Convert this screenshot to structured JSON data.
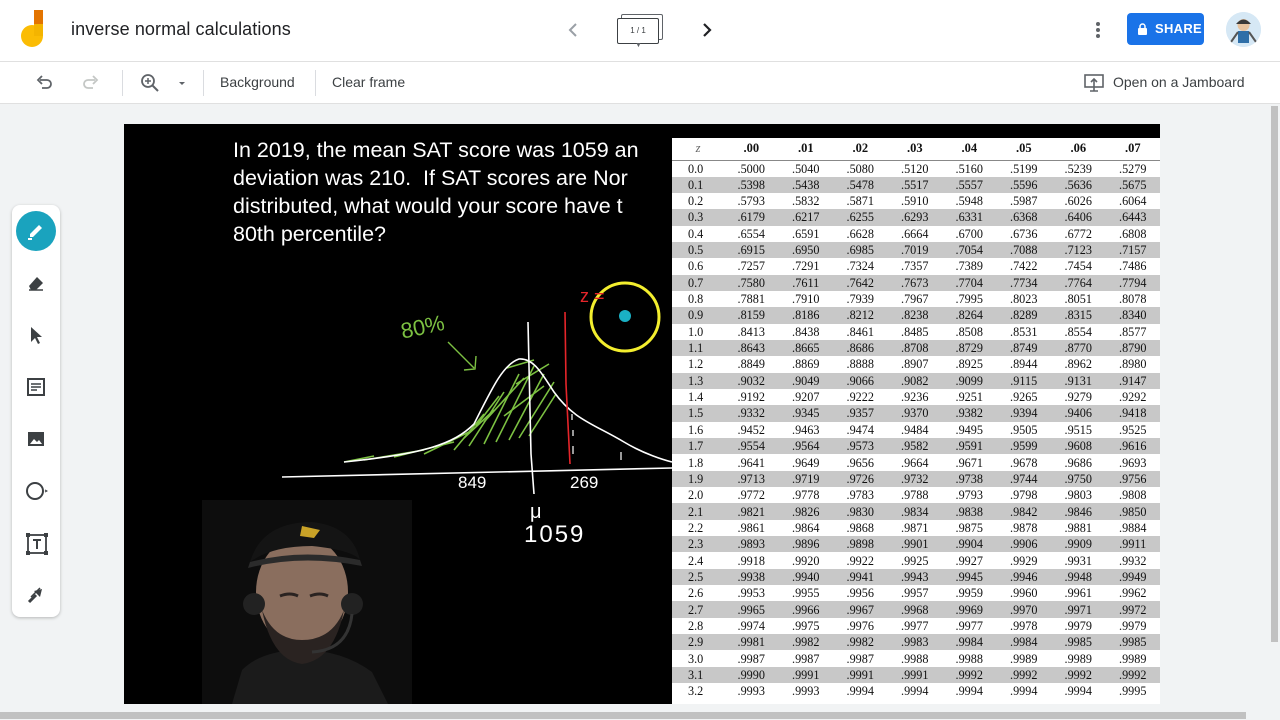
{
  "header": {
    "title": "inverse normal calculations",
    "frame_indicator": "1 / 1",
    "share_label": "SHARE",
    "brand_color": "#1a73e8",
    "logo_colors": [
      "#f4b400",
      "#fbbc04",
      "#e37400"
    ]
  },
  "toolbar": {
    "undo_icon": "undo-icon",
    "redo_icon": "redo-icon",
    "zoom_icon": "zoom-icon",
    "background_label": "Background",
    "clear_frame_label": "Clear frame",
    "open_jamboard_label": "Open on a Jamboard"
  },
  "tools": [
    {
      "name": "pen",
      "icon": "pen-icon",
      "active": true
    },
    {
      "name": "eraser",
      "icon": "eraser-icon"
    },
    {
      "name": "select",
      "icon": "cursor-icon"
    },
    {
      "name": "sticky-note",
      "icon": "sticky-note-icon"
    },
    {
      "name": "image",
      "icon": "image-icon"
    },
    {
      "name": "shape",
      "icon": "circle-icon"
    },
    {
      "name": "text-box",
      "icon": "text-box-icon"
    },
    {
      "name": "laser",
      "icon": "laser-icon"
    }
  ],
  "canvas": {
    "problem_text": "In 2019, the mean SAT score was 1059 an\ndeviation was 210.  If SAT scores are Nor\ndistributed, what would your score have t\n80th percentile?",
    "annotations": {
      "percent": "80%",
      "left_value": "849",
      "right_value": "269",
      "mu": "μ",
      "mean": "1059",
      "z_mark": "z ="
    },
    "z_table": {
      "headers": [
        "z",
        ".00",
        ".01",
        ".02",
        ".03",
        ".04",
        ".05",
        ".06",
        ".07"
      ],
      "rows": [
        [
          "0.0",
          ".5000",
          ".5040",
          ".5080",
          ".5120",
          ".5160",
          ".5199",
          ".5239",
          ".5279"
        ],
        [
          "0.1",
          ".5398",
          ".5438",
          ".5478",
          ".5517",
          ".5557",
          ".5596",
          ".5636",
          ".5675"
        ],
        [
          "0.2",
          ".5793",
          ".5832",
          ".5871",
          ".5910",
          ".5948",
          ".5987",
          ".6026",
          ".6064"
        ],
        [
          "0.3",
          ".6179",
          ".6217",
          ".6255",
          ".6293",
          ".6331",
          ".6368",
          ".6406",
          ".6443"
        ],
        [
          "0.4",
          ".6554",
          ".6591",
          ".6628",
          ".6664",
          ".6700",
          ".6736",
          ".6772",
          ".6808"
        ],
        [
          "0.5",
          ".6915",
          ".6950",
          ".6985",
          ".7019",
          ".7054",
          ".7088",
          ".7123",
          ".7157"
        ],
        [
          "0.6",
          ".7257",
          ".7291",
          ".7324",
          ".7357",
          ".7389",
          ".7422",
          ".7454",
          ".7486"
        ],
        [
          "0.7",
          ".7580",
          ".7611",
          ".7642",
          ".7673",
          ".7704",
          ".7734",
          ".7764",
          ".7794"
        ],
        [
          "0.8",
          ".7881",
          ".7910",
          ".7939",
          ".7967",
          ".7995",
          ".8023",
          ".8051",
          ".8078"
        ],
        [
          "0.9",
          ".8159",
          ".8186",
          ".8212",
          ".8238",
          ".8264",
          ".8289",
          ".8315",
          ".8340"
        ],
        [
          "1.0",
          ".8413",
          ".8438",
          ".8461",
          ".8485",
          ".8508",
          ".8531",
          ".8554",
          ".8577"
        ],
        [
          "1.1",
          ".8643",
          ".8665",
          ".8686",
          ".8708",
          ".8729",
          ".8749",
          ".8770",
          ".8790"
        ],
        [
          "1.2",
          ".8849",
          ".8869",
          ".8888",
          ".8907",
          ".8925",
          ".8944",
          ".8962",
          ".8980"
        ],
        [
          "1.3",
          ".9032",
          ".9049",
          ".9066",
          ".9082",
          ".9099",
          ".9115",
          ".9131",
          ".9147"
        ],
        [
          "1.4",
          ".9192",
          ".9207",
          ".9222",
          ".9236",
          ".9251",
          ".9265",
          ".9279",
          ".9292"
        ],
        [
          "1.5",
          ".9332",
          ".9345",
          ".9357",
          ".9370",
          ".9382",
          ".9394",
          ".9406",
          ".9418"
        ],
        [
          "1.6",
          ".9452",
          ".9463",
          ".9474",
          ".9484",
          ".9495",
          ".9505",
          ".9515",
          ".9525"
        ],
        [
          "1.7",
          ".9554",
          ".9564",
          ".9573",
          ".9582",
          ".9591",
          ".9599",
          ".9608",
          ".9616"
        ],
        [
          "1.8",
          ".9641",
          ".9649",
          ".9656",
          ".9664",
          ".9671",
          ".9678",
          ".9686",
          ".9693"
        ],
        [
          "1.9",
          ".9713",
          ".9719",
          ".9726",
          ".9732",
          ".9738",
          ".9744",
          ".9750",
          ".9756"
        ],
        [
          "2.0",
          ".9772",
          ".9778",
          ".9783",
          ".9788",
          ".9793",
          ".9798",
          ".9803",
          ".9808"
        ],
        [
          "2.1",
          ".9821",
          ".9826",
          ".9830",
          ".9834",
          ".9838",
          ".9842",
          ".9846",
          ".9850"
        ],
        [
          "2.2",
          ".9861",
          ".9864",
          ".9868",
          ".9871",
          ".9875",
          ".9878",
          ".9881",
          ".9884"
        ],
        [
          "2.3",
          ".9893",
          ".9896",
          ".9898",
          ".9901",
          ".9904",
          ".9906",
          ".9909",
          ".9911"
        ],
        [
          "2.4",
          ".9918",
          ".9920",
          ".9922",
          ".9925",
          ".9927",
          ".9929",
          ".9931",
          ".9932"
        ],
        [
          "2.5",
          ".9938",
          ".9940",
          ".9941",
          ".9943",
          ".9945",
          ".9946",
          ".9948",
          ".9949"
        ],
        [
          "2.6",
          ".9953",
          ".9955",
          ".9956",
          ".9957",
          ".9959",
          ".9960",
          ".9961",
          ".9962"
        ],
        [
          "2.7",
          ".9965",
          ".9966",
          ".9967",
          ".9968",
          ".9969",
          ".9970",
          ".9971",
          ".9972"
        ],
        [
          "2.8",
          ".9974",
          ".9975",
          ".9976",
          ".9977",
          ".9977",
          ".9978",
          ".9979",
          ".9979"
        ],
        [
          "2.9",
          ".9981",
          ".9982",
          ".9982",
          ".9983",
          ".9984",
          ".9984",
          ".9985",
          ".9985"
        ],
        [
          "3.0",
          ".9987",
          ".9987",
          ".9987",
          ".9988",
          ".9988",
          ".9989",
          ".9989",
          ".9989"
        ],
        [
          "3.1",
          ".9990",
          ".9991",
          ".9991",
          ".9991",
          ".9992",
          ".9992",
          ".9992",
          ".9992"
        ],
        [
          "3.2",
          ".9993",
          ".9993",
          ".9994",
          ".9994",
          ".9994",
          ".9994",
          ".9994",
          ".9995"
        ]
      ]
    },
    "colors": {
      "canvas_bg": "#000000",
      "ink_white": "#ffffff",
      "ink_green": "#7cc142",
      "ink_red": "#e5252a",
      "highlight_yellow": "#f3ee2e",
      "laser_dot": "#1ab0c4"
    }
  }
}
